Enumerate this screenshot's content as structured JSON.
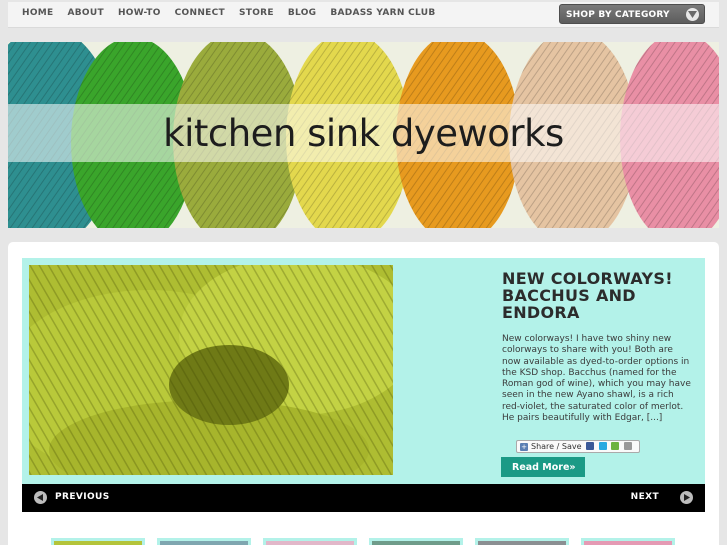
{
  "nav": {
    "items": [
      "HOME",
      "ABOUT",
      "HOW-TO",
      "CONNECT",
      "STORE",
      "BLOG",
      "BADASS YARN CLUB"
    ],
    "shop_select": "SHOP BY CATEGORY"
  },
  "banner": {
    "title": "kitchen sink dyeworks"
  },
  "slide": {
    "title": "NEW COLORWAYS! BACCHUS AND ENDORA",
    "excerpt": "New colorways! I have two shiny new colorways to share with you! Both are now available as dyed-to-order options in the KSD shop. Bacchus (named for the Roman god of wine), which you may have seen in the new Ayano shawl, is a rich red-violet, the saturated color of merlot. He pairs beautifully with Edgar, [...]",
    "share_label": "Share / Save",
    "read_more": "Read More»"
  },
  "pager": {
    "previous": "PREVIOUS",
    "next": "NEXT"
  },
  "colors": {
    "accent_teal": "#1b9a86",
    "slider_bg": "#b3f2e9"
  }
}
